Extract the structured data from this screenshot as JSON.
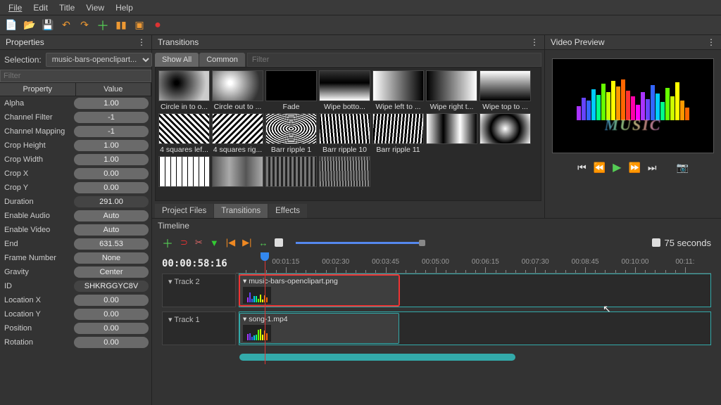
{
  "menu": [
    "File",
    "Edit",
    "Title",
    "View",
    "Help"
  ],
  "panels": {
    "properties_title": "Properties",
    "transitions_title": "Transitions",
    "preview_title": "Video Preview",
    "timeline_title": "Timeline"
  },
  "selection": {
    "label": "Selection:",
    "value": "music-bars-openclipart..."
  },
  "filter_placeholder": "Filter",
  "prop_headers": {
    "name": "Property",
    "value": "Value"
  },
  "properties": [
    {
      "name": "Alpha",
      "value": "1.00",
      "editable": true
    },
    {
      "name": "Channel Filter",
      "value": "-1",
      "editable": true
    },
    {
      "name": "Channel Mapping",
      "value": "-1",
      "editable": true
    },
    {
      "name": "Crop Height",
      "value": "1.00",
      "editable": true
    },
    {
      "name": "Crop Width",
      "value": "1.00",
      "editable": true
    },
    {
      "name": "Crop X",
      "value": "0.00",
      "editable": true
    },
    {
      "name": "Crop Y",
      "value": "0.00",
      "editable": true
    },
    {
      "name": "Duration",
      "value": "291.00",
      "editable": false
    },
    {
      "name": "Enable Audio",
      "value": "Auto",
      "editable": true
    },
    {
      "name": "Enable Video",
      "value": "Auto",
      "editable": true
    },
    {
      "name": "End",
      "value": "631.53",
      "editable": true
    },
    {
      "name": "Frame Number",
      "value": "None",
      "editable": true
    },
    {
      "name": "Gravity",
      "value": "Center",
      "editable": true
    },
    {
      "name": "ID",
      "value": "SHKRGGYC8V",
      "editable": false
    },
    {
      "name": "Location X",
      "value": "0.00",
      "editable": true
    },
    {
      "name": "Location Y",
      "value": "0.00",
      "editable": true
    },
    {
      "name": "Position",
      "value": "0.00",
      "editable": true
    },
    {
      "name": "Rotation",
      "value": "0.00",
      "editable": true
    }
  ],
  "trans_tabs": {
    "show_all": "Show All",
    "common": "Common",
    "filter_ph": "Filter"
  },
  "transitions": [
    "Circle in to o...",
    "Circle out to ...",
    "Fade",
    "Wipe botto...",
    "Wipe left to ...",
    "Wipe right t...",
    "Wipe top to ...",
    "4 squares lef...",
    "4 squares rig...",
    "Barr ripple 1",
    "Barr ripple 10",
    "Barr ripple 11"
  ],
  "file_tabs": [
    "Project Files",
    "Transitions",
    "Effects"
  ],
  "file_tabs_active": 1,
  "preview_text": "MUSIC",
  "timeline": {
    "timecode": "00:00:58:16",
    "duration_label": "75 seconds",
    "ticks": [
      "00:01:15",
      "00:02:30",
      "00:03:45",
      "00:05:00",
      "00:06:15",
      "00:07:30",
      "00:08:45",
      "00:10:00",
      "00:11:"
    ],
    "tracks": [
      {
        "name": "Track 2",
        "clip": "music-bars-openclipart.png",
        "selected": true,
        "left": 0,
        "width": 34
      },
      {
        "name": "Track 1",
        "clip": "song-1.mp4",
        "selected": false,
        "left": 0,
        "width": 34
      }
    ],
    "playhead_pct": 6
  },
  "colors": {
    "accent": "#3aa",
    "play": "#5c5",
    "record": "#d33"
  }
}
